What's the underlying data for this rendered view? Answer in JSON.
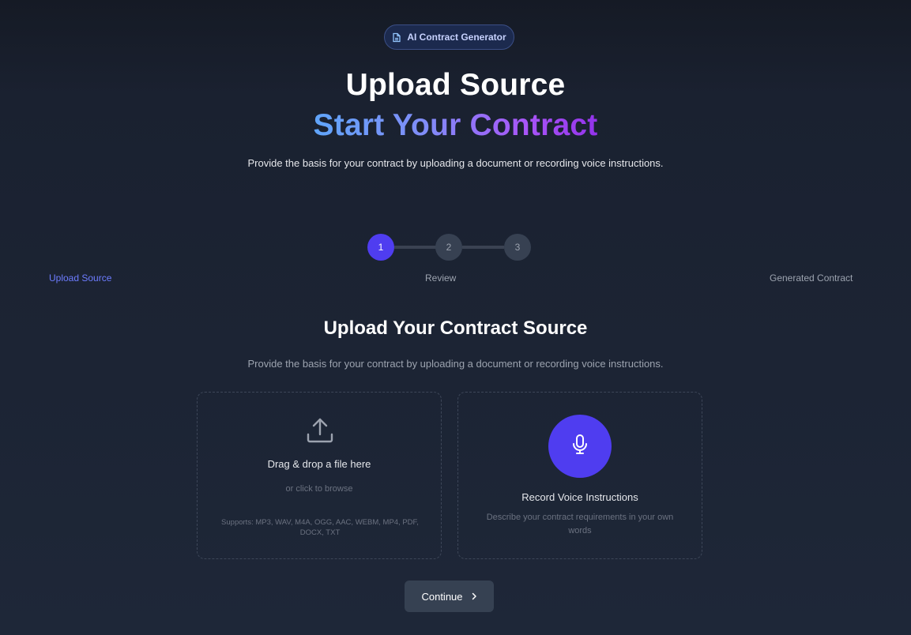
{
  "badge": {
    "label": "AI Contract Generator",
    "icon": "document-icon"
  },
  "header": {
    "title": "Upload Source",
    "subtitle": "Start Your Contract",
    "description": "Provide the basis for your contract by uploading a document or recording voice instructions."
  },
  "steps": [
    {
      "number": "1",
      "label": "Upload Source",
      "active": true
    },
    {
      "number": "2",
      "label": "Review",
      "active": false
    },
    {
      "number": "3",
      "label": "Generated Contract",
      "active": false
    }
  ],
  "section": {
    "title": "Upload Your Contract Source",
    "description": "Provide the basis for your contract by uploading a document or recording voice instructions."
  },
  "upload": {
    "icon": "upload-icon",
    "title": "Drag & drop a file here",
    "subtitle": "or click to browse",
    "formats": "Supports: MP3, WAV, M4A, OGG, AAC, WEBM, MP4, PDF, DOCX, TXT"
  },
  "voice": {
    "icon": "microphone-icon",
    "title": "Record Voice Instructions",
    "description": "Describe your contract requirements in your own words"
  },
  "continue_button": {
    "label": "Continue",
    "icon": "chevron-right-icon"
  },
  "colors": {
    "accent": "#4f3df0",
    "active_step_label": "#6d7cff",
    "gradient_start": "#60a5fa",
    "gradient_end": "#9333ea"
  }
}
